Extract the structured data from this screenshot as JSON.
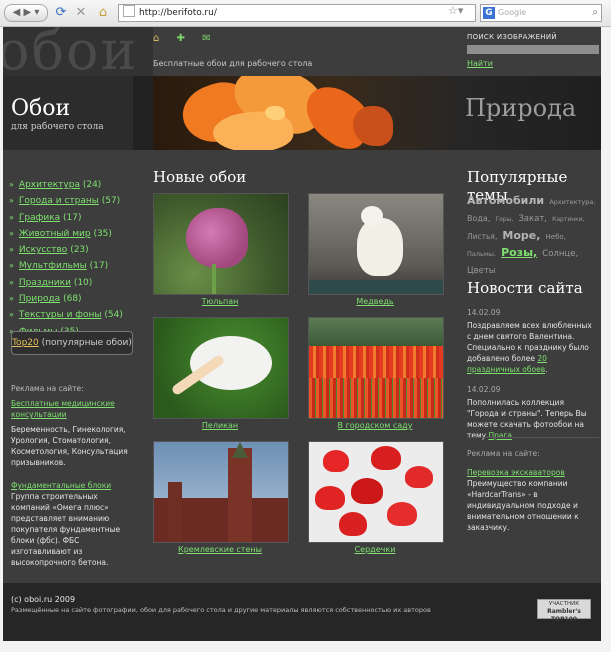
{
  "browser": {
    "url": "http://berifoto.ru/",
    "search_placeholder": "Google",
    "search_engine_glyph": "G"
  },
  "header": {
    "site_name_ghost": "обои",
    "tagline": "Бесплатные обои для рабочего стола",
    "logo_title": "Обои",
    "logo_subtitle": "для рабочего стола",
    "banner_title": "Природа",
    "icons": [
      "home-icon",
      "plus-icon",
      "mail-icon"
    ]
  },
  "search": {
    "label": "ПОИСК ИЗОБРАЖЕНИЙ",
    "value": "",
    "button": "Найти"
  },
  "categories": [
    {
      "name": "Архитектура",
      "count": "(24)"
    },
    {
      "name": "Города и страны",
      "count": "(57)"
    },
    {
      "name": "Графика",
      "count": "(17)"
    },
    {
      "name": "Животный мир",
      "count": "(35)"
    },
    {
      "name": "Искусство",
      "count": "(23)"
    },
    {
      "name": "Мультфильмы",
      "count": "(17)"
    },
    {
      "name": "Праздники",
      "count": "(10)"
    },
    {
      "name": "Природа",
      "count": "(68)"
    },
    {
      "name": "Текстуры и фоны",
      "count": "(54)"
    },
    {
      "name": "Фильмы",
      "count": "(35)"
    }
  ],
  "top20": {
    "link": "Top20",
    "rest": " (популярные обои)"
  },
  "ads_left": {
    "heading": "Реклама на сайте:",
    "ad1_link": "Бесплатные медицинские консультации",
    "ad1_text": "Беременность, Гинекология, Урология, Стоматология, Косметология, Консультация призывников.",
    "ad2_link": "Фундаментальные блоки",
    "ad2_text": "Группа строительных компаний «Омега плюс» представляет вниманию покупателя фундаментные блоки (фбс). ФБС изготавливают из высокопрочного бетона."
  },
  "main": {
    "title": "Новые обои",
    "items": [
      {
        "caption": "Тюльпан"
      },
      {
        "caption": "Медведь"
      },
      {
        "caption": "Пеликан"
      },
      {
        "caption": "В городском саду"
      },
      {
        "caption": "Кремлевские стены"
      },
      {
        "caption": "Сердечки"
      }
    ]
  },
  "popular": {
    "title": "Популярные темы",
    "tags": [
      {
        "t": "Автомобили",
        "size": 11,
        "bold": true,
        "color": "#b5b5b5"
      },
      {
        "t": "Архитектура,",
        "size": 6.5,
        "bold": false,
        "color": "#9a9a9a"
      },
      {
        "t": "Вода,",
        "size": 8,
        "bold": false,
        "color": "#9a9a9a"
      },
      {
        "t": "Горы,",
        "size": 6,
        "bold": false,
        "color": "#9a9a9a"
      },
      {
        "t": "Закат,",
        "size": 8.5,
        "bold": false,
        "color": "#9a9a9a"
      },
      {
        "t": "Картинки,",
        "size": 6,
        "bold": false,
        "color": "#9a9a9a"
      },
      {
        "t": "Листья,",
        "size": 7.5,
        "bold": false,
        "color": "#9a9a9a"
      },
      {
        "t": "Море,",
        "size": 11,
        "bold": true,
        "color": "#b5b5b5"
      },
      {
        "t": "Небо,",
        "size": 7,
        "bold": false,
        "color": "#9a9a9a"
      },
      {
        "t": "Пальмы,",
        "size": 6.5,
        "bold": false,
        "color": "#9a9a9a"
      },
      {
        "t": "Розы,",
        "size": 11,
        "bold": true,
        "color": "#7fe070"
      },
      {
        "t": "Солнце,",
        "size": 8.5,
        "bold": false,
        "color": "#9a9a9a"
      },
      {
        "t": "Цветы",
        "size": 8.5,
        "bold": false,
        "color": "#9a9a9a"
      }
    ]
  },
  "news": {
    "title": "Новости сайта",
    "items": [
      {
        "date": "14.02.09",
        "text": "Поздравляем всех влюбленных с днем святого Валентина. Специально к празднику было добавлено более ",
        "link": "20 праздничных обоев",
        "tail": "."
      },
      {
        "date": "14.02.09",
        "text": "Пополнилась коллекция \"Города и страны\". Теперь Вы можете скачать фотообои на тему ",
        "link": "Прага",
        "tail": "."
      }
    ]
  },
  "ads_right": {
    "heading": "Реклама на сайте:",
    "link": "Перевозка экскаваторов",
    "text": "Преимущество компании «HardcarTrans» - в индивидуальном подходе и внимательном отношении к заказчику."
  },
  "footer": {
    "copyright": "(c) oboi.ru 2009",
    "note": "Размещённые на сайте фотографии, обои для рабочего стола и другие материалы являются собственностью их авторов",
    "badge_top": "УЧАСТНИК",
    "badge_brand": "Rambler's TOP100"
  }
}
